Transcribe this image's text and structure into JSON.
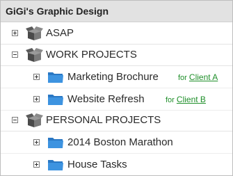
{
  "header": {
    "title": "GiGi's Graphic Design"
  },
  "tree": {
    "asap": {
      "label": "ASAP"
    },
    "work": {
      "label": "WORK PROJECTS",
      "children": [
        {
          "label": "Marketing Brochure",
          "client_prefix": "for",
          "client_link": "Client A"
        },
        {
          "label": "Website Refresh",
          "client_prefix": "for",
          "client_link": "Client B"
        }
      ]
    },
    "personal": {
      "label": "PERSONAL PROJECTS",
      "children": [
        {
          "label": "2014 Boston Marathon"
        },
        {
          "label": "House Tasks"
        }
      ]
    }
  },
  "colors": {
    "header_bg": "#e2e2e2",
    "folder_blue": "#2f86d6",
    "client_green": "#1f8f2a"
  },
  "icons": {
    "project": "box-icon",
    "task_list": "folder-icon",
    "expand": "plus-icon",
    "collapse": "minus-icon"
  }
}
